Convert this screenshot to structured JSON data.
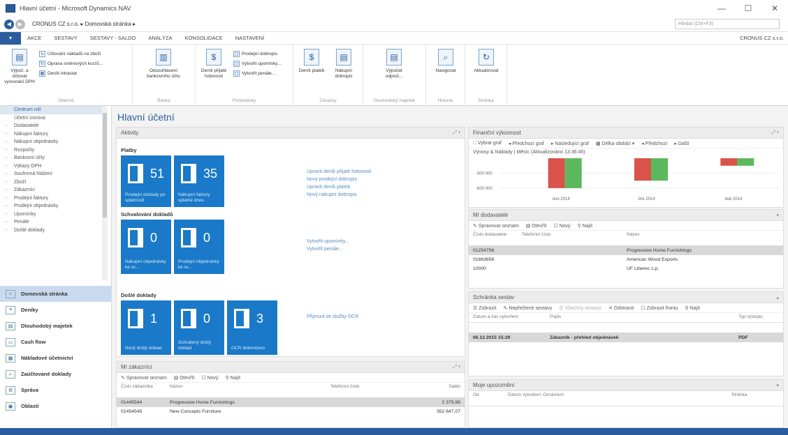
{
  "window": {
    "title": "Hlavní účetní - Microsoft Dynamics NAV",
    "minimize": "—",
    "maximize": "☐",
    "close": "✕"
  },
  "address": {
    "crumb": "CRONUS CZ s.r.o. ▸ Domovská stránka ▸",
    "search_placeholder": "Hledat (Ctrl+F3)"
  },
  "menu": {
    "items": [
      "AKCE",
      "SESTAVY",
      "SESTAVY - SALDO",
      "ANALÝZA",
      "KONSOLIDACE",
      "NASTAVENÍ"
    ],
    "company": "CRONUS CZ s.r.o."
  },
  "ribbon": {
    "groups": [
      {
        "label": "Obecné",
        "big": "Výpoč. a účtovat vyrovnání DPH",
        "small": [
          "Účtování nákladů na zboží",
          "Oprava směnových kurzů...",
          "Deník intrastat"
        ]
      },
      {
        "label": "Banka",
        "big": "Odsouhlasení bankovního účtu"
      },
      {
        "label": "Pohledávky",
        "big": "Deník přijaté hotovosti",
        "small": [
          "Prodejní dobropis",
          "Vytvořit upomínky...",
          "Vytvořit penále..."
        ]
      },
      {
        "label": "Závazky",
        "big1": "Deník plateb",
        "big2": "Nákupní dobropis"
      },
      {
        "label": "Dlouhodobý majetek",
        "big": "Výpočet odpisů..."
      },
      {
        "label": "Historie",
        "big": "Navigovat"
      },
      {
        "label": "Stránka",
        "big": "Aktualizovat"
      }
    ]
  },
  "nav": {
    "items": [
      "Centrum rolí",
      "Účetní osnova",
      "Dodavatelé",
      "Nákupní faktury",
      "Nákupní objednávky",
      "Rozpočty",
      "Bankovní účty",
      "Výkazy DPH",
      "Souhrnná hlášení",
      "Zboží",
      "Zákazníci",
      "Prodejní faktury",
      "Prodejní objednávky",
      "Upomínky",
      "Penále",
      "Došlé doklady"
    ],
    "sections": [
      "Domovská stránka",
      "Deníky",
      "Dlouhodobý majetek",
      "Cash flow",
      "Nákladové účetnictví",
      "Zaúčtované doklady",
      "Správa",
      "Oblasti"
    ]
  },
  "page": {
    "title": "Hlavní účetní"
  },
  "activities": {
    "header": "Aktivity",
    "platby": {
      "label": "Platby",
      "tiles": [
        {
          "value": "51",
          "label": "Prodejní doklady po splatnosti"
        },
        {
          "value": "35",
          "label": "Nákupní faktury splatné dnes"
        }
      ],
      "links": [
        "Upravit deník přijaté hotovosti",
        "Nový prodejní dobropis",
        "Upravit deník plateb",
        "Nový nákupní dobropis"
      ]
    },
    "schvalovani": {
      "label": "Schvalování dokladů",
      "tiles": [
        {
          "value": "0",
          "label": "Nákupní objednávky ke sc..."
        },
        {
          "value": "0",
          "label": "Prodejní objednávky ke sc..."
        }
      ],
      "links": [
        "Vytvořit upomínky...",
        "Vytvořit penále..."
      ]
    },
    "dosle": {
      "label": "Došlé doklady",
      "tiles": [
        {
          "value": "1",
          "label": "Nový došlý doklad"
        },
        {
          "value": "0",
          "label": "Schválený došlý doklad"
        },
        {
          "value": "3",
          "label": "OCR dokončeno"
        }
      ],
      "links": [
        "Přijmout ze služby OCR"
      ]
    }
  },
  "customers": {
    "header": "Mí zákazníci",
    "toolbar": [
      "Spravovat seznam",
      "Otevřít",
      "Nový",
      "Najít"
    ],
    "columns": [
      "Číslo zákazníka",
      "Název",
      "Telefonní číslo",
      "Saldo"
    ],
    "rows": [
      [
        "01445544",
        "Progressive Home Furnishings",
        "",
        "2 379,96"
      ],
      [
        "01454545",
        "New Concepts Furniture",
        "",
        "352 647,07"
      ]
    ]
  },
  "finance": {
    "header": "Finanční výkonnost",
    "toolbar": [
      "Vybrat graf",
      "Předchozí graf",
      "Následující graf",
      "Délka období",
      "Předchozí",
      "Další"
    ],
    "subtitle": "Výnosy & Náklady | Měsíc (Aktualizováno 13:36:45)",
    "colors": {
      "expense": "#d9534a",
      "revenue": "#5cb85c"
    }
  },
  "chart_data": {
    "type": "bar",
    "categories": [
      "úno 2014",
      "bře 2014",
      "dub 2014"
    ],
    "series": [
      {
        "values": [
          -600000,
          -450000,
          -150000
        ]
      },
      {
        "values": [
          -600000,
          -450000,
          -150000
        ]
      }
    ],
    "yticks": [
      "-300 000",
      "-600 000"
    ],
    "ylim": [
      -700000,
      0
    ]
  },
  "vendors": {
    "header": "Mí dodavatelé",
    "toolbar": [
      "Spravovat seznam",
      "Otevřít",
      "Nový",
      "Najít"
    ],
    "columns": [
      "Číslo dodavatele",
      "Telefonní číslo",
      "Název"
    ],
    "rows": [
      [
        "01254796",
        "",
        "Progressive Home Furnishings"
      ],
      [
        "01863656",
        "",
        "American Wood Exports"
      ],
      [
        "10000",
        "",
        "UF Liberec s.p."
      ]
    ]
  },
  "reports": {
    "header": "Schránka sestav",
    "toolbar": [
      "Zobrazit",
      "Nepřečtené sestavy",
      "Všechny sestavy",
      "Odstranit",
      "Zobrazit frontu",
      "Najít"
    ],
    "columns": [
      "Datum a čas vytvoření",
      "Popis",
      "Typ výstupu"
    ],
    "rows": [
      [
        "06.12.2015 15:29",
        "Zákazník - přehled objednávek",
        "PDF"
      ]
    ]
  },
  "notifications": {
    "header": "Moje upozornění",
    "columns": [
      "Od",
      "Datum vytvoření",
      "Oznámení",
      "Stránka"
    ]
  }
}
